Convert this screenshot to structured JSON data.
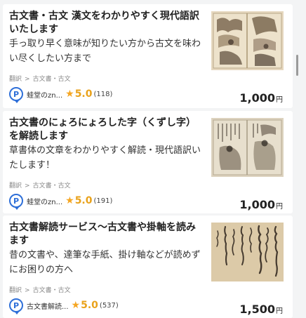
{
  "listings": [
    {
      "title": "古文書・古文 漢文をわかりやすく現代語訳いたします",
      "description": "手っ取り早く意味が知りたい方から古文を味わい尽くしたい方まで",
      "breadcrumb": [
        "翻訳",
        "古文書・古文"
      ],
      "seller_name": "蛙堂のzn...",
      "rating": "5.0",
      "review_count": "(118)",
      "price": "1,000",
      "price_unit": "円",
      "thumbnail_icon": "woodblock-print-image"
    },
    {
      "title": "古文書のにょろにょろした字（くずし字）を解読します",
      "description": "草書体の文章をわかりやすく解読・現代語訳いたします！",
      "breadcrumb": [
        "翻訳",
        "古文書・古文"
      ],
      "seller_name": "蛙堂のzn...",
      "rating": "5.0",
      "review_count": "(191)",
      "price": "1,000",
      "price_unit": "円",
      "thumbnail_icon": "illustrated-manuscript-image"
    },
    {
      "title": "古文書解読サービス～古文書や掛軸を読みます",
      "description": "昔の文書や、達筆な手紙、掛け軸などが読めずにお困りの方へ",
      "breadcrumb": [
        "翻訳",
        "古文書・古文"
      ],
      "seller_name": "古文書解読...",
      "rating": "5.0",
      "review_count": "(537)",
      "price": "1,500",
      "price_unit": "円",
      "thumbnail_icon": "calligraphy-scroll-image"
    }
  ],
  "badge_letter": "P",
  "colors": {
    "background": "#f3f4f5",
    "card": "#ffffff",
    "badge_blue": "#2e6fd8",
    "star_orange": "#f5a623",
    "rating_orange": "#e9a21b"
  }
}
